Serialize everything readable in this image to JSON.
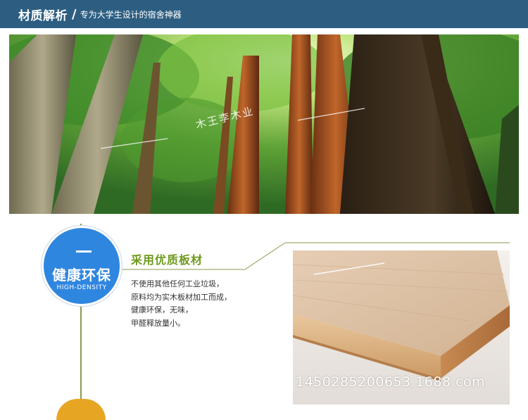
{
  "header": {
    "title": "材质解析",
    "slash": "/",
    "subtitle": "专为大学生设计的宿舍神器"
  },
  "forest": {
    "watermark": "木王李木业"
  },
  "feature": {
    "number": "一",
    "name": "健康环保",
    "name_en": "HIGH-DENSITY",
    "title": "采用优质板材",
    "desc_lines": [
      "不使用其他任何工业垃圾，",
      "原料均为实木板材加工而成，",
      "健康环保，无味，",
      "甲醛释放量小。"
    ]
  },
  "board": {
    "watermark": "1450285200653.1688.com"
  },
  "colors": {
    "header_bg": "#2d5e82",
    "circle_blue": "#2f86df",
    "title_green": "#6e9a1e",
    "line_olive": "#8b9a4a",
    "next_orange": "#e6a624"
  }
}
